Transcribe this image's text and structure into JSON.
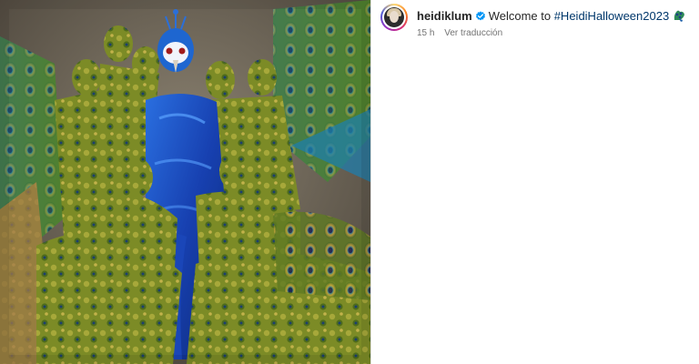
{
  "post": {
    "image_alt": "Group of performers in peacock body paint around a figure in a blue peacock costume",
    "image_icon": "photo-icon"
  },
  "caption": {
    "username": "heidiklum",
    "verified_icon": "verified-badge-icon",
    "text": "Welcome to ",
    "hashtag": "#HeidiHalloween2023",
    "emoji_icon": "peacock-emoji-icon"
  },
  "meta": {
    "time_ago": "15 h",
    "see_translation": "Ver traducción"
  },
  "colors": {
    "username": "#262626",
    "hashtag": "#00376b",
    "meta": "#737373",
    "verified": "#0095f6",
    "costume_blue": "#1f4fc4",
    "paint_green": "#7a8a2a"
  }
}
